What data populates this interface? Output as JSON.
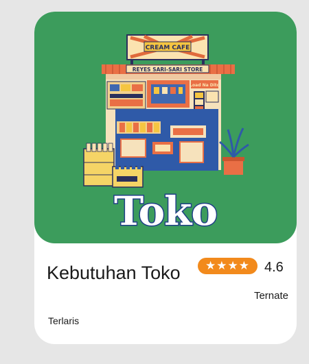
{
  "card": {
    "hero": {
      "signs": {
        "top": "CREAM CAFE",
        "store": "REYES SARI-SARI STORE",
        "load": "Load Na Dito"
      },
      "logo_text": "Toko"
    },
    "title": "Kebutuhan Toko",
    "rating": {
      "stars": "★★★★",
      "star_count": 4,
      "value": "4.6"
    },
    "location": "Ternate",
    "badge": "Terlaris"
  },
  "colors": {
    "page_background": "#e6e6e6",
    "hero_background": "#3c9c5c",
    "rating_accent": "#f28a1c",
    "logo_outline": "#1f3f86"
  }
}
